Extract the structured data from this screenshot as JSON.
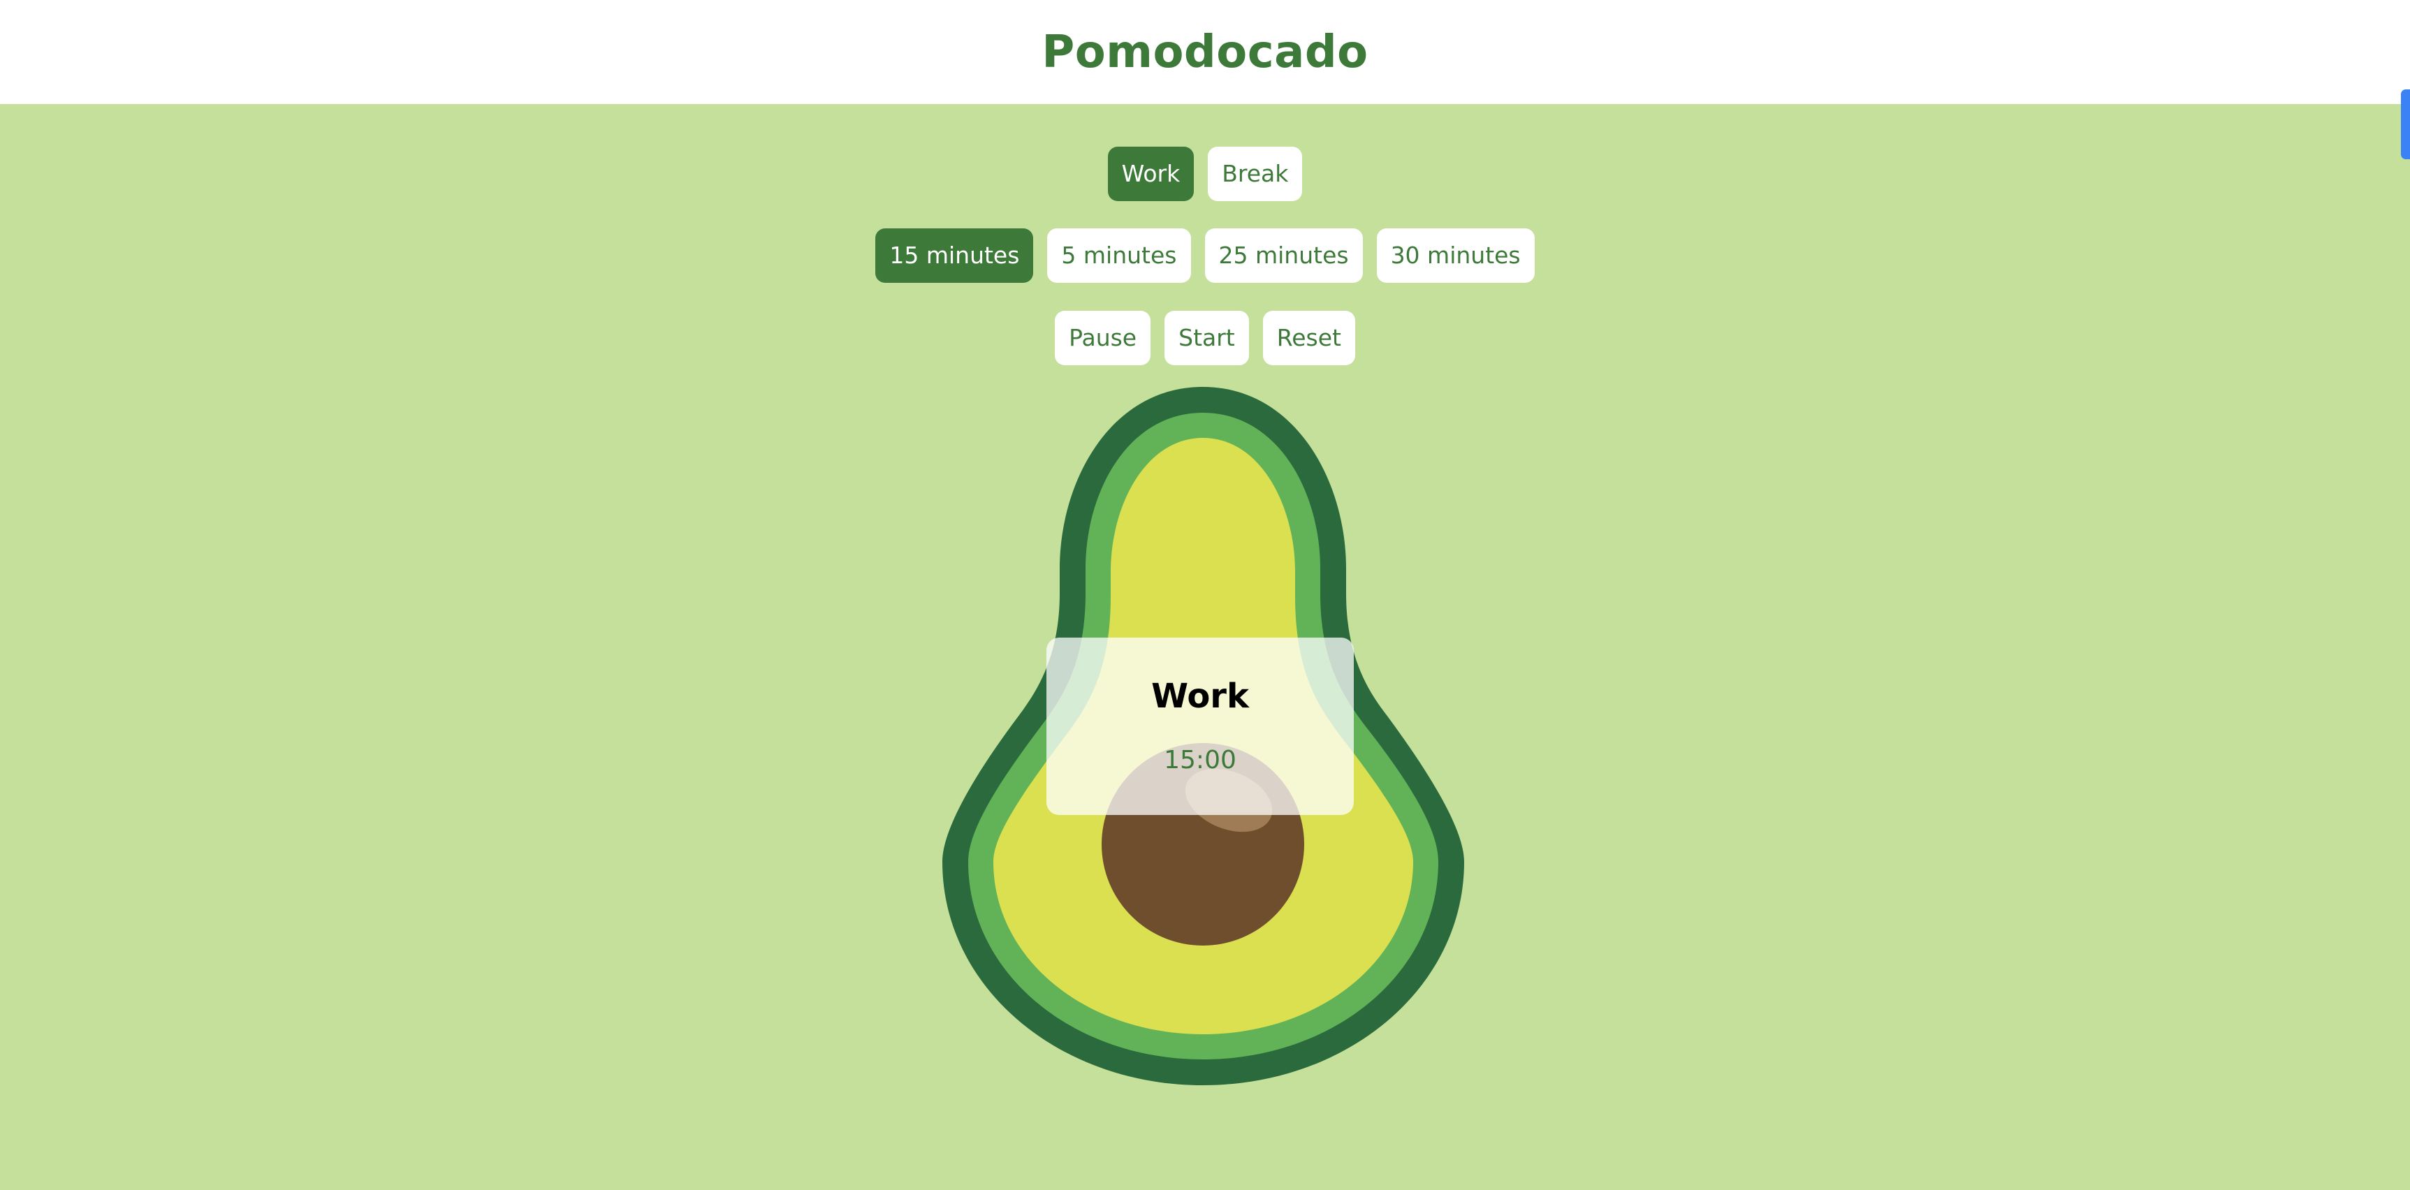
{
  "app": {
    "title": "Pomodocado"
  },
  "mode_buttons": [
    {
      "label": "Work",
      "active": true
    },
    {
      "label": "Break",
      "active": false
    }
  ],
  "duration_buttons": [
    {
      "label": "15 minutes",
      "active": true
    },
    {
      "label": "5 minutes",
      "active": false
    },
    {
      "label": "25 minutes",
      "active": false
    },
    {
      "label": "30 minutes",
      "active": false
    }
  ],
  "control_buttons": [
    {
      "label": "Pause"
    },
    {
      "label": "Start"
    },
    {
      "label": "Reset"
    }
  ],
  "timer": {
    "mode_label": "Work",
    "time": "15:00"
  },
  "colors": {
    "brand_green": "#3d7a3a",
    "background": "#c5e09b",
    "avocado_skin": "#2a6a3c",
    "avocado_flesh_outer": "#62b358",
    "avocado_flesh_inner": "#dbe050",
    "pit": "#6f4e2e",
    "pit_highlight": "#a07c56",
    "scrollbar": "#3b82f6"
  },
  "icons": {
    "avocado": "avocado-illustration"
  }
}
